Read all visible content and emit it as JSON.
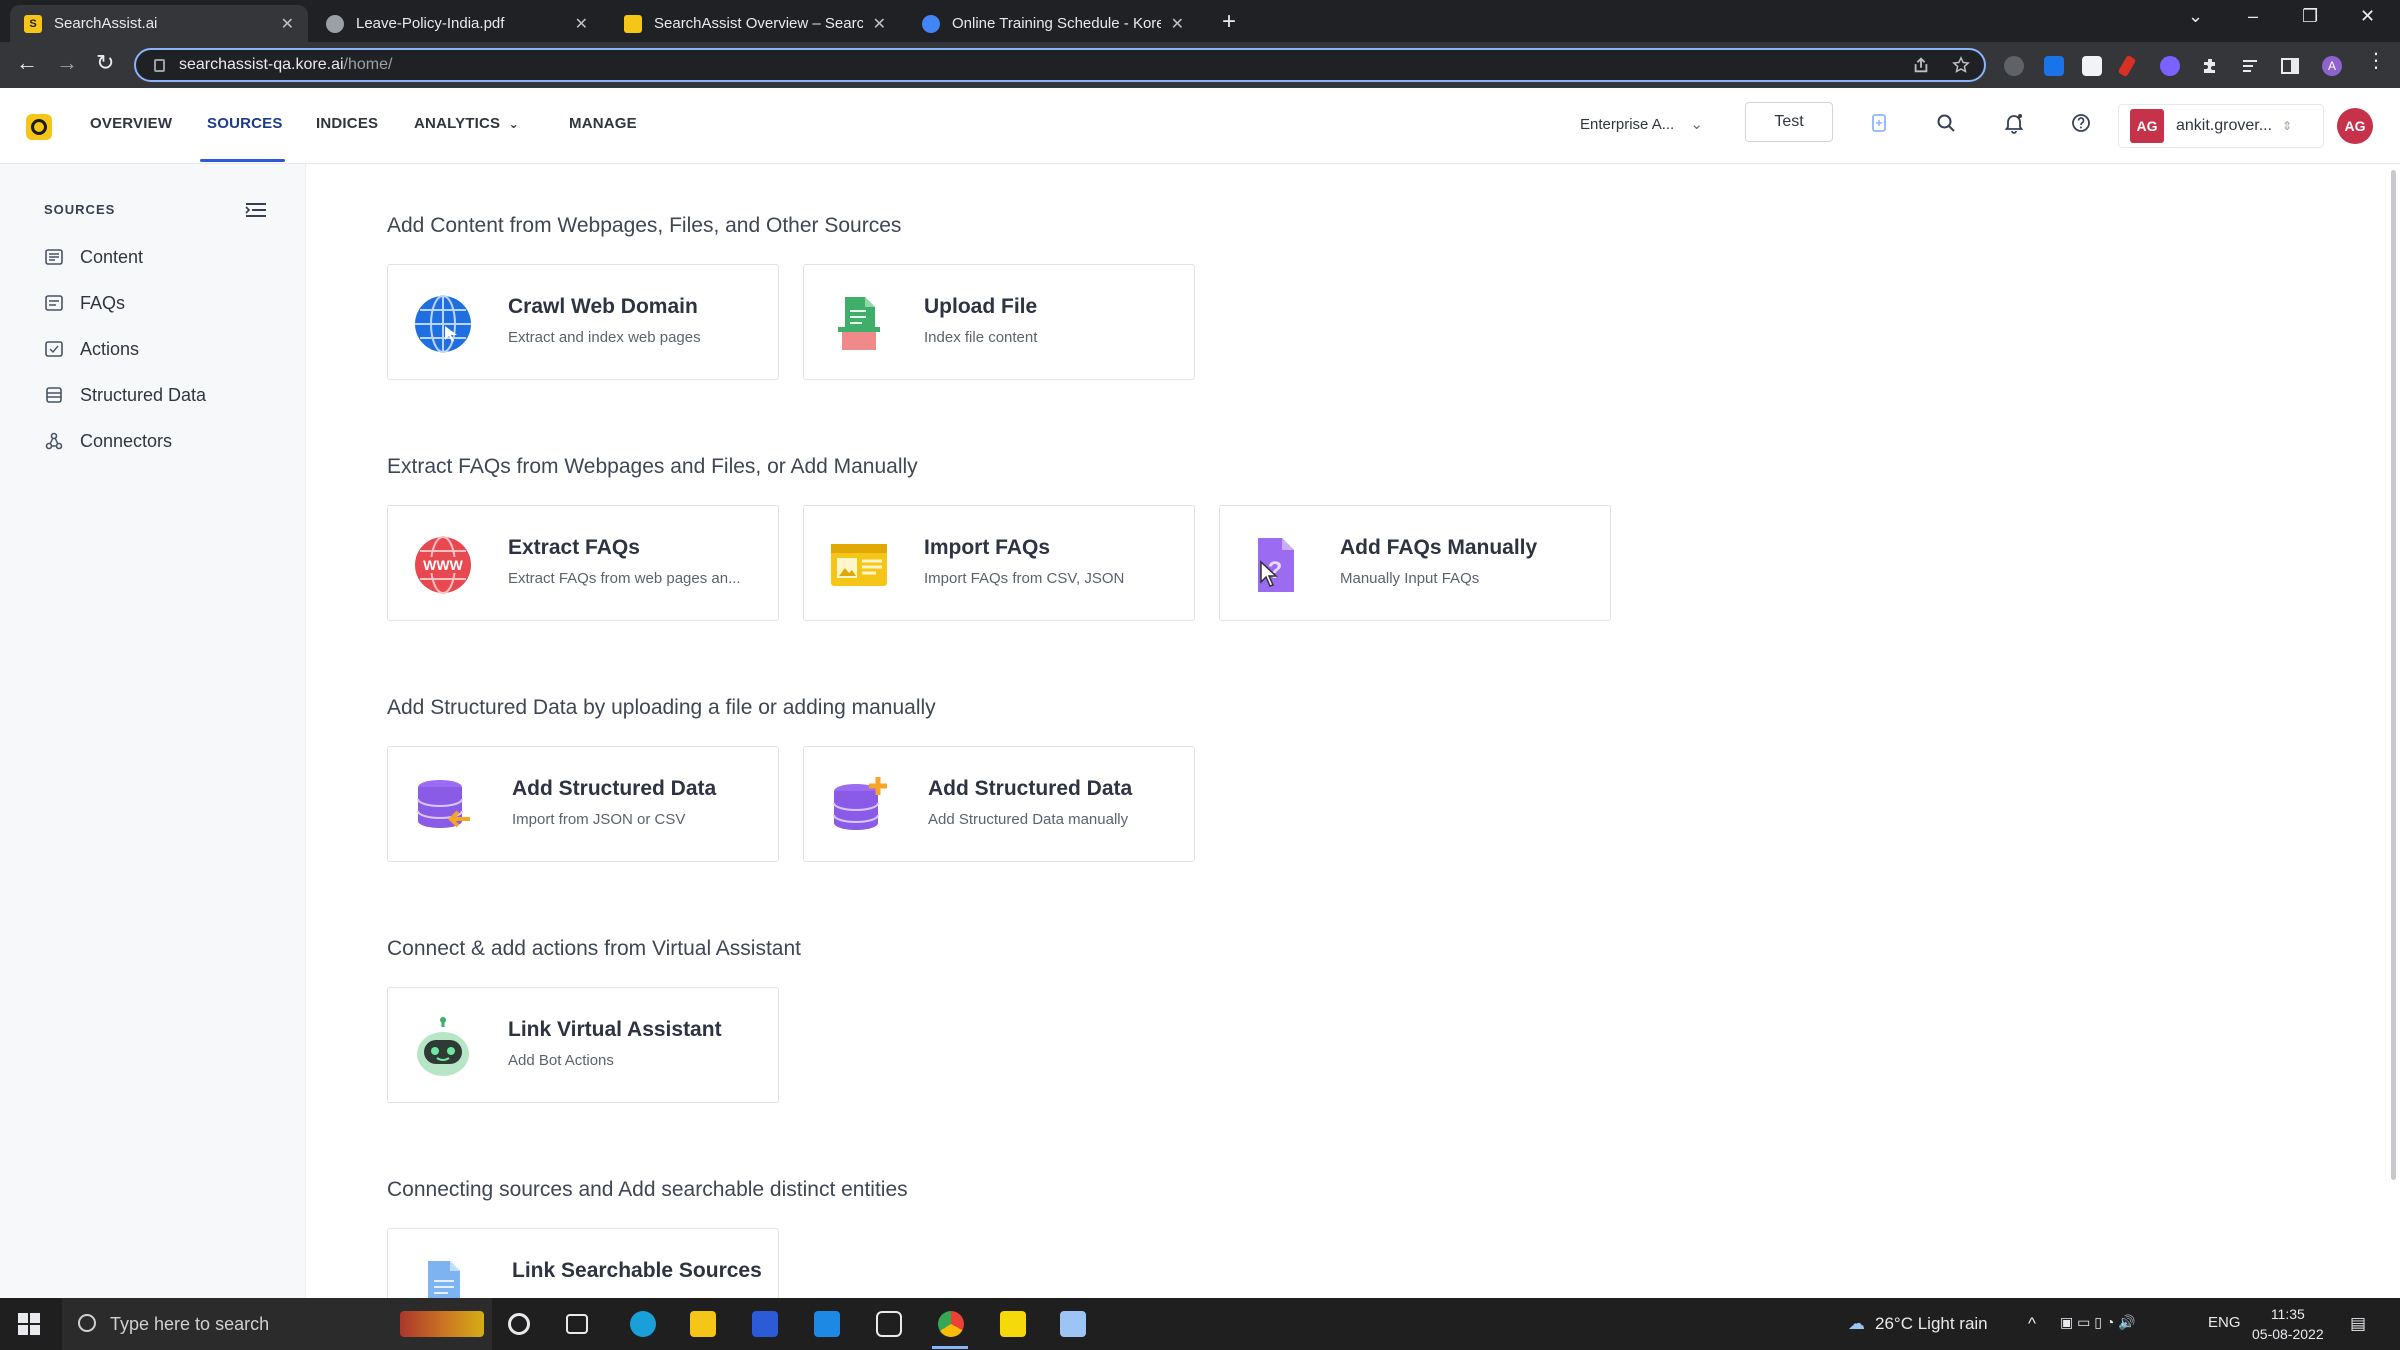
{
  "browser": {
    "tabs": [
      {
        "title": "SearchAssist.ai",
        "active": true
      },
      {
        "title": "Leave-Policy-India.pdf",
        "active": false
      },
      {
        "title": "SearchAssist Overview – SearchA",
        "active": false
      },
      {
        "title": "Online Training Schedule - Kore.",
        "active": false
      }
    ],
    "url_host": "searchassist-qa.kore.ai",
    "url_path": "/home/"
  },
  "header": {
    "nav": [
      {
        "label": "OVERVIEW"
      },
      {
        "label": "SOURCES",
        "active": true
      },
      {
        "label": "INDICES"
      },
      {
        "label": "ANALYTICS"
      },
      {
        "label": "MANAGE"
      }
    ],
    "environment": "Enterprise A...",
    "test_label": "Test",
    "user_initials": "AG",
    "user_name": "ankit.grover..."
  },
  "sidebar": {
    "title": "SOURCES",
    "items": [
      {
        "label": "Content",
        "icon": "content-icon"
      },
      {
        "label": "FAQs",
        "icon": "faq-icon"
      },
      {
        "label": "Actions",
        "icon": "actions-icon"
      },
      {
        "label": "Structured Data",
        "icon": "database-icon"
      },
      {
        "label": "Connectors",
        "icon": "connectors-icon"
      }
    ]
  },
  "main": {
    "sections": [
      {
        "title": "Add Content from Webpages, Files, and Other Sources",
        "cards": [
          {
            "title": "Crawl Web Domain",
            "subtitle": "Extract and index web pages",
            "icon": "globe-icon"
          },
          {
            "title": "Upload File",
            "subtitle": "Index file content",
            "icon": "file-upload-icon"
          }
        ]
      },
      {
        "title": "Extract FAQs from Webpages and Files, or Add Manually",
        "cards": [
          {
            "title": "Extract FAQs",
            "subtitle": "Extract FAQs from web pages an...",
            "icon": "www-icon"
          },
          {
            "title": "Import FAQs",
            "subtitle": "Import FAQs from CSV, JSON",
            "icon": "import-icon"
          },
          {
            "title": "Add FAQs Manually",
            "subtitle": "Manually Input FAQs",
            "icon": "question-doc-icon"
          }
        ]
      },
      {
        "title": "Add Structured Data by uploading a file or adding manually",
        "cards": [
          {
            "title": "Add Structured Data",
            "subtitle": "Import from JSON or CSV",
            "icon": "database-import-icon"
          },
          {
            "title": "Add Structured Data",
            "subtitle": "Add Structured Data manually",
            "icon": "database-add-icon"
          }
        ]
      },
      {
        "title": "Connect & add actions from Virtual Assistant",
        "cards": [
          {
            "title": "Link Virtual Assistant",
            "subtitle": "Add Bot Actions",
            "icon": "bot-icon"
          }
        ]
      },
      {
        "title": "Connecting sources and Add searchable distinct entities",
        "cards": [
          {
            "title": "Link Searchable Sources",
            "subtitle": "",
            "icon": "link-doc-icon"
          }
        ]
      }
    ]
  },
  "taskbar": {
    "search_placeholder": "Type here to search",
    "weather": "26°C  Light rain",
    "language": "ENG",
    "time": "11:35",
    "date": "05-08-2022"
  }
}
